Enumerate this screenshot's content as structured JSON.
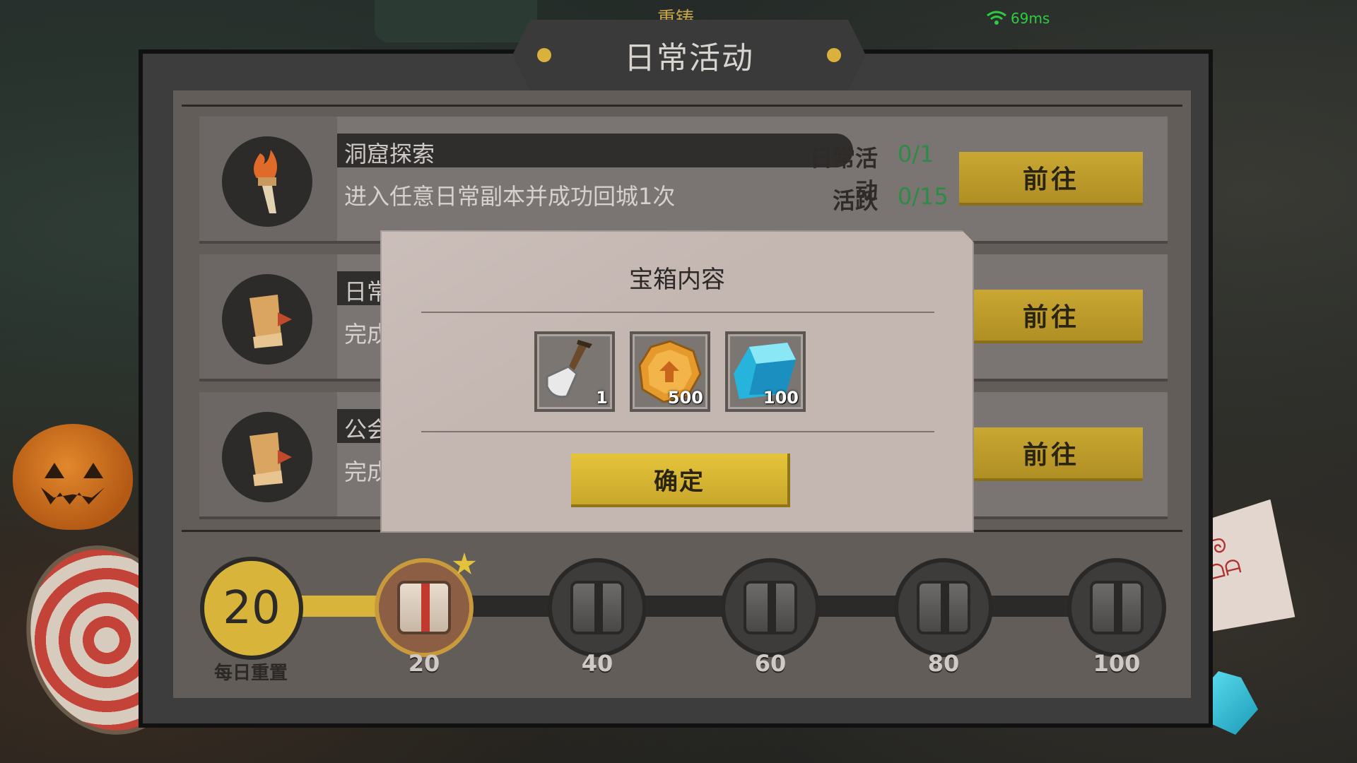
{
  "header": {
    "title": "日常活动",
    "top_label": "重铸",
    "ping": "69ms"
  },
  "tasks": [
    {
      "name": "洞窟探索",
      "desc": "进入任意日常副本并成功回城1次",
      "stat1_label": "日常活动",
      "stat1_value": "0/1",
      "stat2_label": "活跃",
      "stat2_value": "0/15",
      "button": "前往",
      "icon": "torch-icon"
    },
    {
      "name": "日常",
      "desc": "完成",
      "button": "前往",
      "icon": "scroll-icon"
    },
    {
      "name": "公会",
      "desc": "完成",
      "button": "前往",
      "icon": "scroll-icon"
    }
  ],
  "progress": {
    "current": "20",
    "reset_label": "每日重置",
    "fill_fraction": 0.16,
    "milestones": [
      "20",
      "40",
      "60",
      "80",
      "100"
    ]
  },
  "modal": {
    "title": "宝箱内容",
    "items": [
      {
        "icon": "shovel-icon",
        "qty": "1"
      },
      {
        "icon": "gold-coin-icon",
        "qty": "500"
      },
      {
        "icon": "blue-crystal-icon",
        "qty": "100"
      }
    ],
    "confirm": "确定"
  }
}
